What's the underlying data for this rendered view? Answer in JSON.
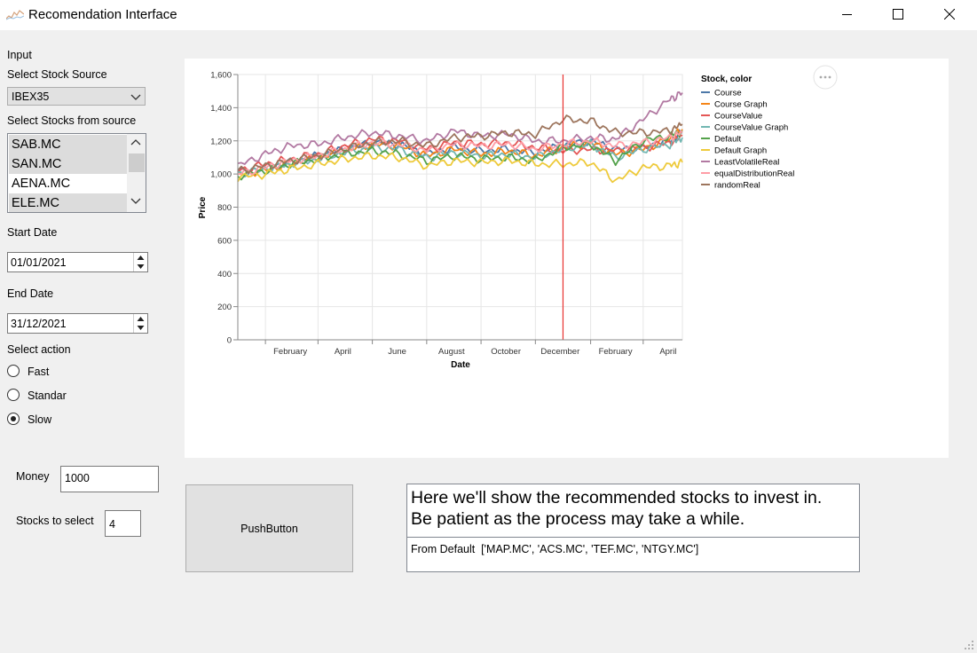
{
  "window": {
    "title": "Recomendation Interface"
  },
  "input": {
    "section_label": "Input",
    "source_label": "Select Stock Source",
    "source_value": "IBEX35",
    "stocks_label": "Select Stocks from source",
    "stocks": [
      {
        "label": "SAB.MC",
        "selected": true
      },
      {
        "label": "SAN.MC",
        "selected": true
      },
      {
        "label": "AENA.MC",
        "selected": false
      },
      {
        "label": "ELE.MC",
        "selected": true
      }
    ],
    "start_label": "Start Date",
    "start_value": "01/01/2021",
    "end_label": "End Date",
    "end_value": "31/12/2021",
    "action_label": "Select action",
    "actions": [
      {
        "label": "Fast",
        "checked": false
      },
      {
        "label": "Standar",
        "checked": false
      },
      {
        "label": "Slow",
        "checked": true
      }
    ],
    "money_label": "Money",
    "money_value": "1000",
    "count_label": "Stocks to select",
    "count_value": "4"
  },
  "push_button": "PushButton",
  "output": {
    "message_line1": "Here we'll show the recommended stocks to invest in.",
    "message_line2": "Be patient as the process may take a while.",
    "result": "From Default  ['MAP.MC', 'ACS.MC', 'TEF.MC', 'NTGY.MC']"
  },
  "chart_data": {
    "type": "line",
    "xlabel": "Date",
    "ylabel": "Price",
    "ylim": [
      0,
      1600
    ],
    "y_ticks": [
      0,
      200,
      400,
      600,
      800,
      1000,
      1200,
      1400,
      1600
    ],
    "y_tick_labels": [
      "0",
      "200",
      "400",
      "600",
      "800",
      "1,000",
      "1,200",
      "1,400",
      "1,600"
    ],
    "x_tick_labels": [
      "February",
      "April",
      "June",
      "August",
      "October",
      "December",
      "February",
      "April"
    ],
    "x_range": [
      "2021-01-01",
      "2022-05-15"
    ],
    "x_ticks": [
      "2021-02-01",
      "2021-04-01",
      "2021-06-01",
      "2021-08-01",
      "2021-10-01",
      "2021-12-01",
      "2022-02-01",
      "2022-04-01"
    ],
    "vertical_rule": "2022-01-01",
    "rule_color": "#e8312f",
    "grid": true,
    "legend_title": "Stock, color",
    "legend_position": "top-right",
    "x": [
      "2021-01-01",
      "2021-02-01",
      "2021-03-01",
      "2021-04-01",
      "2021-05-01",
      "2021-06-01",
      "2021-07-01",
      "2021-08-01",
      "2021-09-01",
      "2021-10-01",
      "2021-11-01",
      "2021-12-01",
      "2022-01-01",
      "2022-02-01",
      "2022-03-01",
      "2022-04-01",
      "2022-05-01",
      "2022-05-15"
    ],
    "series": [
      {
        "name": "Course",
        "color": "#4c78a8",
        "values": [
          1010,
          1040,
          1070,
          1110,
          1150,
          1190,
          1180,
          1120,
          1160,
          1140,
          1150,
          1130,
          1170,
          1200,
          1150,
          1160,
          1200,
          1250
        ]
      },
      {
        "name": "Course Graph",
        "color": "#f58518",
        "values": [
          1000,
          1020,
          1060,
          1100,
          1140,
          1180,
          1170,
          1110,
          1150,
          1120,
          1140,
          1110,
          1160,
          1190,
          1120,
          1150,
          1210,
          1270
        ]
      },
      {
        "name": "CourseValue",
        "color": "#e45756",
        "values": [
          1020,
          1060,
          1090,
          1120,
          1170,
          1210,
          1200,
          1150,
          1190,
          1180,
          1190,
          1160,
          1140,
          1150,
          1140,
          1160,
          1190,
          1230
        ]
      },
      {
        "name": "CourseValue Graph",
        "color": "#72b7b2",
        "values": [
          1000,
          1030,
          1060,
          1090,
          1130,
          1160,
          1150,
          1100,
          1130,
          1110,
          1120,
          1100,
          1150,
          1180,
          1100,
          1150,
          1180,
          1220
        ]
      },
      {
        "name": "Default",
        "color": "#54a24b",
        "values": [
          990,
          1020,
          1060,
          1090,
          1120,
          1140,
          1120,
          1080,
          1110,
          1090,
          1100,
          1080,
          1160,
          1180,
          1080,
          1200,
          1230,
          1260
        ]
      },
      {
        "name": "Default Graph",
        "color": "#eeca3b",
        "values": [
          980,
          1000,
          1030,
          1060,
          1090,
          1110,
          1100,
          1050,
          1080,
          1070,
          1080,
          1060,
          1060,
          1070,
          960,
          1040,
          1050,
          1070
        ]
      },
      {
        "name": "LeastVolatileReal",
        "color": "#b279a2",
        "values": [
          1050,
          1120,
          1170,
          1180,
          1220,
          1250,
          1230,
          1200,
          1260,
          1230,
          1240,
          1200,
          1200,
          1220,
          1210,
          1330,
          1450,
          1490
        ]
      },
      {
        "name": "equalDistributionReal",
        "color": "#ff9da6",
        "values": [
          1000,
          1040,
          1080,
          1110,
          1150,
          1190,
          1180,
          1140,
          1180,
          1170,
          1180,
          1150,
          1180,
          1200,
          1170,
          1190,
          1220,
          1250
        ]
      },
      {
        "name": "randomReal",
        "color": "#9d755d",
        "values": [
          1020,
          1050,
          1080,
          1110,
          1150,
          1190,
          1200,
          1170,
          1220,
          1230,
          1250,
          1240,
          1330,
          1320,
          1250,
          1250,
          1260,
          1300
        ]
      }
    ]
  }
}
